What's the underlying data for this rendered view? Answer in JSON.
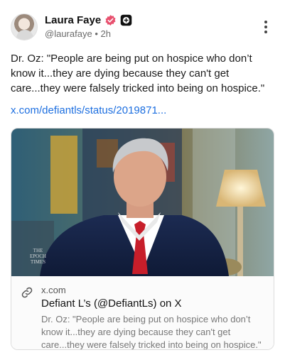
{
  "post": {
    "author": {
      "display_name": "Laura Faye",
      "handle": "@laurafaye",
      "time": "• 2h",
      "verified_color": "#e8506e"
    },
    "text": "Dr. Oz: \"People are being put on hospice who don’t know it...they are dying because they can't get care...they were falsely tricked into being on hospice.\"",
    "link_text": "x.com/defiantls/status/2019871..."
  },
  "card": {
    "image_watermark": [
      "THE",
      "EPOCH",
      "TIMES"
    ],
    "domain": "x.com",
    "title": "Defiant L’s (@DefiantLs) on X",
    "description": "Dr. Oz: \"People are being put on hospice who don’t know it...they are dying because they can't get care...they were falsely tricked into being on hospice.\""
  },
  "colors": {
    "link": "#1d6fe0",
    "accent": "#e8506e"
  }
}
